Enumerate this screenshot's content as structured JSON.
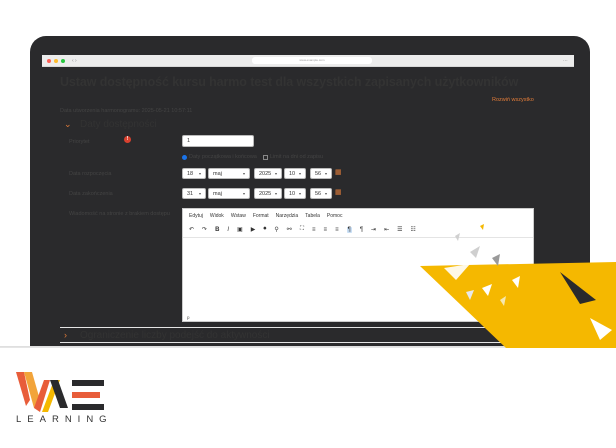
{
  "browser": {
    "url": "www.example.com"
  },
  "page": {
    "title": "Ustaw dostępność kursu harmo test dla wszystkich zapisanych użytkowników",
    "expand_all": "Rozwiń wszystko",
    "created": "Data utworzenia harmonogramu: 2025-05-21 10:57:11"
  },
  "section1": {
    "label": "Daty dostępności"
  },
  "form": {
    "priority_label": "Priorytet",
    "priority_value": "1",
    "radio_dates": "Daty początkowa i końcowa",
    "radio_limit": "Limit na dni od zapisu",
    "start_label": "Data rozpoczęcia",
    "start": {
      "day": "18",
      "month": "maj",
      "year": "2025",
      "hour": "10",
      "minute": "56"
    },
    "end_label": "Data zakończenia",
    "end": {
      "day": "31",
      "month": "maj",
      "year": "2025",
      "hour": "10",
      "minute": "56"
    },
    "message_label": "Wiadomość na stronie z brakiem dostępu"
  },
  "editor": {
    "menu": [
      "Edytuj",
      "Widok",
      "Wstaw",
      "Format",
      "Narzędzia",
      "Tabela",
      "Pomoc"
    ],
    "status": "p"
  },
  "section2": {
    "label": "Ograniczenie liczby podejść do aktywności"
  },
  "brand": {
    "logo_text": "LEARNING",
    "accent": "#f5b800",
    "orange": "#e07b39",
    "dark": "#2a2a2c"
  }
}
